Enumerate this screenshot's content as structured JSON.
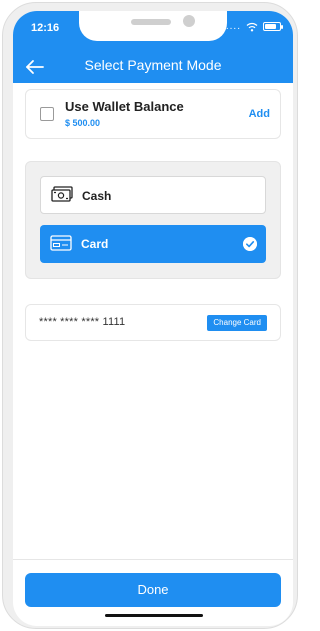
{
  "status_bar": {
    "time": "12:16",
    "signal": "...."
  },
  "header": {
    "title": "Select Payment Mode"
  },
  "wallet": {
    "label": "Use Wallet Balance",
    "amount": "$ 500.00",
    "add_label": "Add"
  },
  "payment_options": [
    {
      "label": "Cash",
      "selected": false,
      "icon": "cash-icon"
    },
    {
      "label": "Card",
      "selected": true,
      "icon": "card-icon"
    }
  ],
  "card": {
    "number": "**** **** **** 1111",
    "change_label": "Change Card"
  },
  "footer": {
    "done_label": "Done"
  },
  "colors": {
    "accent": "#1f8ef1",
    "background": "#ffffff",
    "panel": "#f0f0f0"
  }
}
